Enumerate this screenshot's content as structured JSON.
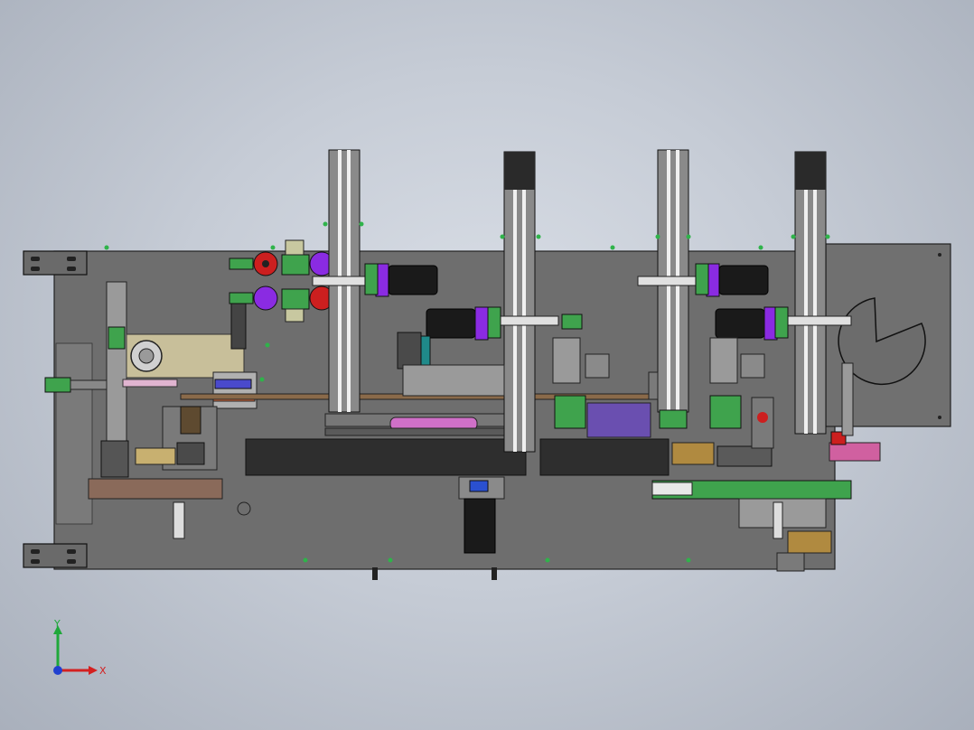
{
  "viewport": {
    "model": "assembly-machine-top-view",
    "background_top": "#d9dee6",
    "background_edge": "#a9b0bc",
    "plate_color": "#6f6f6f",
    "accent_green": "#3fa34d",
    "accent_purple": "#8a2be2",
    "accent_red": "#cc1f1f",
    "motor_color": "#1a1a1a"
  },
  "triad": {
    "x_label": "X",
    "y_label": "Y",
    "x_color": "#d42020",
    "y_color": "#1fa83a",
    "z_color": "#2040d0"
  }
}
